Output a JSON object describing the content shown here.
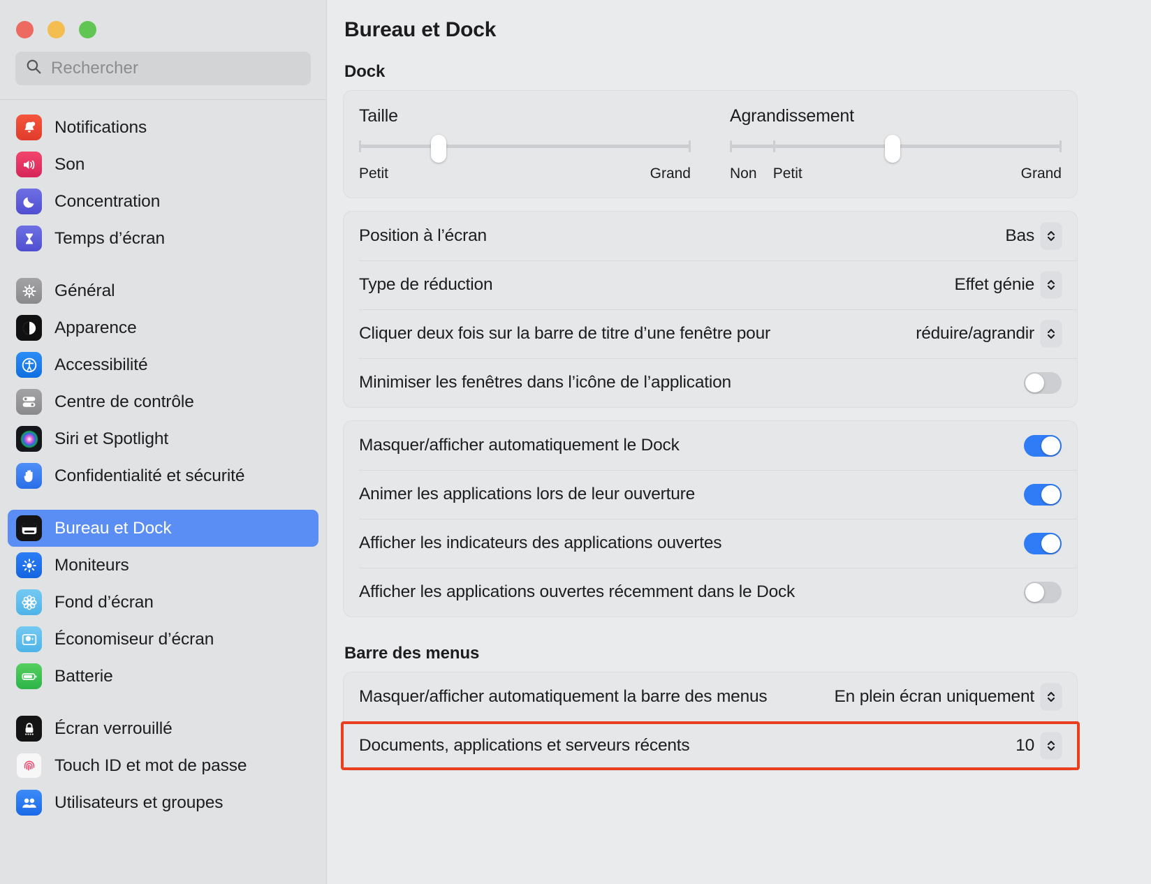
{
  "window": {
    "traffic_lights": [
      "close",
      "minimize",
      "zoom"
    ],
    "colors": {
      "close": "#ec6a5f",
      "minimize": "#f4bd4f",
      "zoom": "#61c554",
      "accent": "#2f7cf6",
      "selection": "#5b8ef5",
      "highlight": "#e8401f"
    }
  },
  "search": {
    "placeholder": "Rechercher",
    "value": ""
  },
  "sidebar": {
    "groups": [
      {
        "items": [
          {
            "label": "Notifications",
            "icon": "bell-icon",
            "selected": false
          },
          {
            "label": "Son",
            "icon": "speaker-icon",
            "selected": false
          },
          {
            "label": "Concentration",
            "icon": "moon-icon",
            "selected": false
          },
          {
            "label": "Temps d’écran",
            "icon": "hourglass-icon",
            "selected": false
          }
        ]
      },
      {
        "items": [
          {
            "label": "Général",
            "icon": "gear-icon",
            "selected": false
          },
          {
            "label": "Apparence",
            "icon": "appearance-icon",
            "selected": false
          },
          {
            "label": "Accessibilité",
            "icon": "accessibility-icon",
            "selected": false
          },
          {
            "label": "Centre de contrôle",
            "icon": "control-center-icon",
            "selected": false
          },
          {
            "label": "Siri et Spotlight",
            "icon": "siri-icon",
            "selected": false
          },
          {
            "label": "Confidentialité et sécurité",
            "icon": "hand-icon",
            "selected": false
          }
        ]
      },
      {
        "items": [
          {
            "label": "Bureau et Dock",
            "icon": "desktop-dock-icon",
            "selected": true
          },
          {
            "label": "Moniteurs",
            "icon": "brightness-icon",
            "selected": false
          },
          {
            "label": "Fond d’écran",
            "icon": "wallpaper-icon",
            "selected": false
          },
          {
            "label": "Économiseur d’écran",
            "icon": "screensaver-icon",
            "selected": false
          },
          {
            "label": "Batterie",
            "icon": "battery-icon",
            "selected": false
          }
        ]
      },
      {
        "items": [
          {
            "label": "Écran verrouillé",
            "icon": "lock-screen-icon",
            "selected": false
          },
          {
            "label": "Touch ID et mot de passe",
            "icon": "fingerprint-icon",
            "selected": false
          },
          {
            "label": "Utilisateurs et groupes",
            "icon": "users-icon",
            "selected": false
          }
        ]
      }
    ]
  },
  "main": {
    "page_title": "Bureau et Dock",
    "sections": [
      {
        "title": "Dock",
        "sliders": [
          {
            "label": "Taille",
            "value_pct": 24,
            "min_label": "Petit",
            "max_label": "Grand",
            "mid_label": "",
            "ticks": []
          },
          {
            "label": "Agrandissement",
            "value_pct": 49,
            "min_label": "Non",
            "mid_label": "Petit",
            "max_label": "Grand",
            "ticks": [
              13
            ]
          }
        ],
        "dropdown_rows": [
          {
            "label": "Position à l’écran",
            "value": "Bas",
            "control": "stepper"
          },
          {
            "label": "Type de réduction",
            "value": "Effet génie",
            "control": "stepper"
          },
          {
            "label": "Cliquer deux fois sur la barre de titre d’une fenêtre pour",
            "value": "réduire/agrandir",
            "control": "stepper"
          },
          {
            "label": "Minimiser les fenêtres dans l’icône de l’application",
            "value": "",
            "control": "toggle",
            "toggle_on": false
          }
        ],
        "toggle_rows": [
          {
            "label": "Masquer/afficher automatiquement le Dock",
            "toggle_on": true
          },
          {
            "label": "Animer les applications lors de leur ouverture",
            "toggle_on": true
          },
          {
            "label": "Afficher les indicateurs des applications ouvertes",
            "toggle_on": true
          },
          {
            "label": "Afficher les applications ouvertes récemment dans le Dock",
            "toggle_on": false
          }
        ]
      },
      {
        "title": "Barre des menus",
        "rows": [
          {
            "label": "Masquer/afficher automatiquement la barre des menus",
            "value": "En plein écran uniquement",
            "highlighted": false
          },
          {
            "label": "Documents, applications et serveurs récents",
            "value": "10",
            "highlighted": true
          }
        ]
      }
    ]
  }
}
